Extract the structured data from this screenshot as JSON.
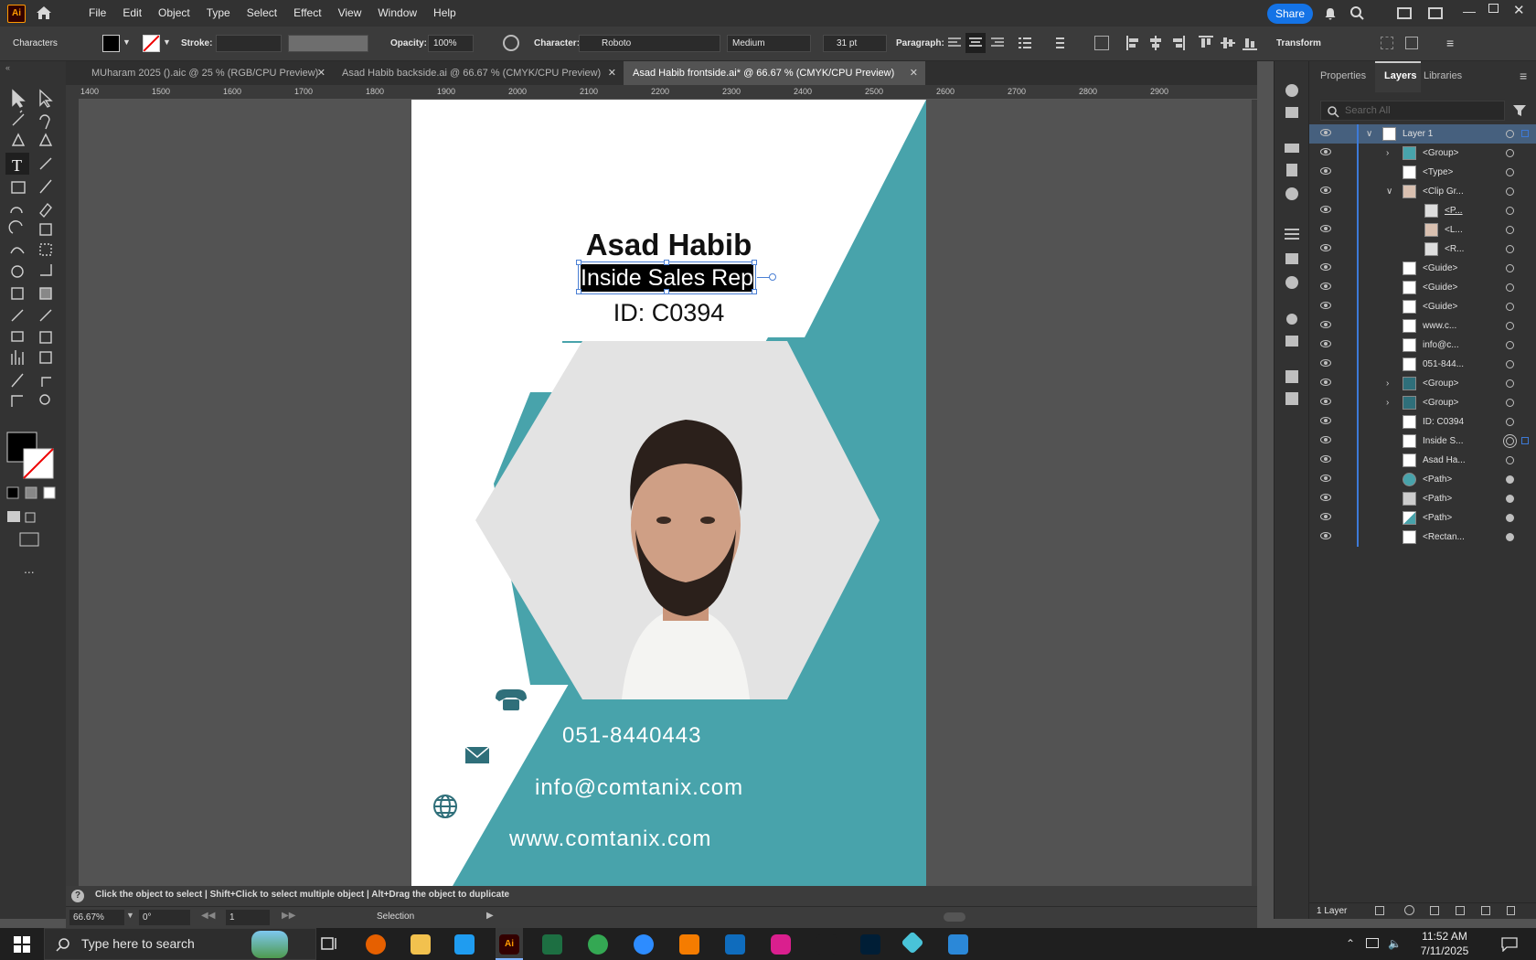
{
  "app": {
    "logo_text": "Ai",
    "menus": [
      "File",
      "Edit",
      "Object",
      "Type",
      "Select",
      "Effect",
      "View",
      "Window",
      "Help"
    ],
    "share_label": "Share"
  },
  "controlbar": {
    "panel_name": "Characters",
    "stroke_label": "Stroke:",
    "opacity_label": "Opacity:",
    "opacity_value": "100%",
    "character_label": "Character:",
    "font_family": "Roboto",
    "font_style": "Medium",
    "font_size": "31 pt",
    "paragraph_label": "Paragraph:",
    "transform_label": "Transform"
  },
  "tabs": [
    {
      "label": "MUharam 2025 ().aic @ 25 % (RGB/CPU Preview)",
      "active": false
    },
    {
      "label": "Asad Habib  backside.ai @ 66.67 % (CMYK/CPU Preview)",
      "active": false
    },
    {
      "label": "Asad Habib frontside.ai* @ 66.67 % (CMYK/CPU Preview)",
      "active": true
    }
  ],
  "ruler_ticks": [
    "1400",
    "1500",
    "1600",
    "1700",
    "1800",
    "1900",
    "2000",
    "2100",
    "2200",
    "2300",
    "2400",
    "2500",
    "2600",
    "2700",
    "2800",
    "2900"
  ],
  "card": {
    "name": "Asad Habib",
    "title": "Inside Sales Rep",
    "id_text": "ID:  C0394",
    "phone": "051-8440443",
    "email": "info@comtanix.com",
    "website": "www.comtanix.com",
    "accent_color": "#48a3ab",
    "dark_accent_color": "#2f6f7a"
  },
  "hint": {
    "text": "Click the object to select  |  Shift+Click to select multiple object  |  Alt+Drag the object to duplicate"
  },
  "status": {
    "zoom": "66.67%",
    "rotation": "0°",
    "artboard": "1",
    "tool": "Selection"
  },
  "panel": {
    "tabs": [
      "Properties",
      "Layers",
      "Libraries"
    ],
    "active_tab": "Layers",
    "search_placeholder": "Search All",
    "layers": [
      {
        "name": "Layer 1",
        "indent": 0,
        "expanded": true,
        "selected": true
      },
      {
        "name": "<Group>",
        "indent": 1,
        "collapsed": true
      },
      {
        "name": "<Type>",
        "indent": 1
      },
      {
        "name": "<Clip Gr...",
        "indent": 1,
        "expanded": true
      },
      {
        "name": "<P...",
        "indent": 2
      },
      {
        "name": "<L...",
        "indent": 2
      },
      {
        "name": "<R...",
        "indent": 2
      },
      {
        "name": "<Guide>",
        "indent": 1
      },
      {
        "name": "<Guide>",
        "indent": 1
      },
      {
        "name": "<Guide>",
        "indent": 1
      },
      {
        "name": "www.c...",
        "indent": 1
      },
      {
        "name": "info@c...",
        "indent": 1
      },
      {
        "name": "051-844...",
        "indent": 1
      },
      {
        "name": "<Group>",
        "indent": 1,
        "collapsed": true
      },
      {
        "name": "<Group>",
        "indent": 1,
        "collapsed": true
      },
      {
        "name": "ID:  C0394",
        "indent": 1
      },
      {
        "name": "Inside S...",
        "indent": 1,
        "target": "double"
      },
      {
        "name": "Asad Ha...",
        "indent": 1
      },
      {
        "name": "<Path>",
        "indent": 1,
        "target": "filled"
      },
      {
        "name": "<Path>",
        "indent": 1,
        "target": "filled"
      },
      {
        "name": "<Path>",
        "indent": 1,
        "target": "filled"
      },
      {
        "name": "<Rectan...",
        "indent": 1,
        "target": "filled"
      }
    ],
    "footer_label": "1 Layer"
  },
  "taskbar": {
    "search_placeholder": "Type here to search",
    "time": "11:52 AM",
    "date": "7/11/2025"
  }
}
